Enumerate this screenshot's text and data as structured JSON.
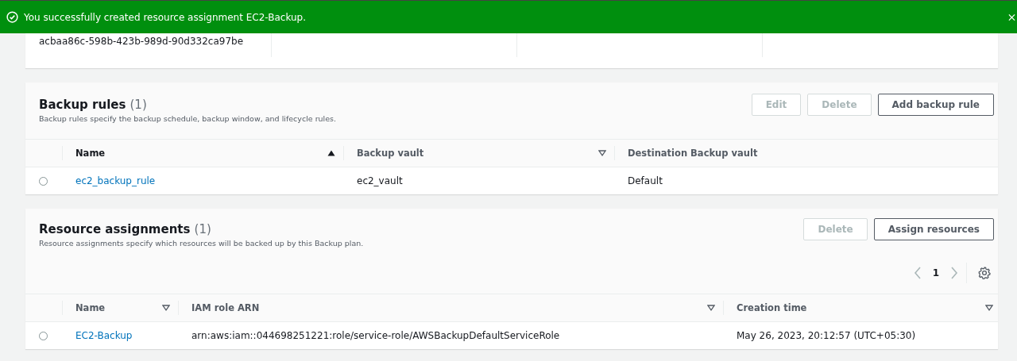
{
  "flash": {
    "message": "You successfully created resource assignment EC2-Backup.",
    "kind": "success"
  },
  "plan_summary": {
    "plan_id": "acbaa86c-598b-423b-989d-90d332ca97be"
  },
  "backup_rules": {
    "title": "Backup rules",
    "count": "(1)",
    "description": "Backup rules specify the backup schedule, backup window, and lifecycle rules.",
    "buttons": [
      {
        "label": "Edit",
        "disabled": true
      },
      {
        "label": "Delete",
        "disabled": true
      },
      {
        "label": "Add backup rule",
        "disabled": false
      }
    ],
    "columns": [
      {
        "label": "Name",
        "sortable": true,
        "sorted": true
      },
      {
        "label": "Backup vault",
        "sortable": true,
        "sorted": false
      },
      {
        "label": "Destination Backup vault",
        "sortable": false,
        "sorted": false
      }
    ],
    "rows": [
      {
        "selected": false,
        "cells": [
          "ec2_backup_rule",
          "ec2_vault",
          "Default"
        ]
      }
    ]
  },
  "resource_assignments": {
    "title": "Resource assignments",
    "count": "(1)",
    "description": "Resource assignments specify which resources will be backed up by this Backup plan.",
    "buttons": [
      {
        "label": "Delete",
        "disabled": true
      },
      {
        "label": "Assign resources",
        "disabled": false
      }
    ],
    "pagination": {
      "page": "1",
      "prev_disabled": true,
      "next_disabled": true
    },
    "columns": [
      {
        "label": "Name",
        "sortable": true,
        "sorted": false
      },
      {
        "label": "IAM role ARN",
        "sortable": true,
        "sorted": false
      },
      {
        "label": "Creation time",
        "sortable": true,
        "sorted": false
      }
    ],
    "rows": [
      {
        "selected": false,
        "cells": [
          "EC2-Backup",
          "arn:aws:iam::044698251221:role/service-role/AWSBackupDefaultServiceRole",
          "May 26, 2023, 20:12:57 (UTC+05:30)"
        ]
      }
    ]
  }
}
